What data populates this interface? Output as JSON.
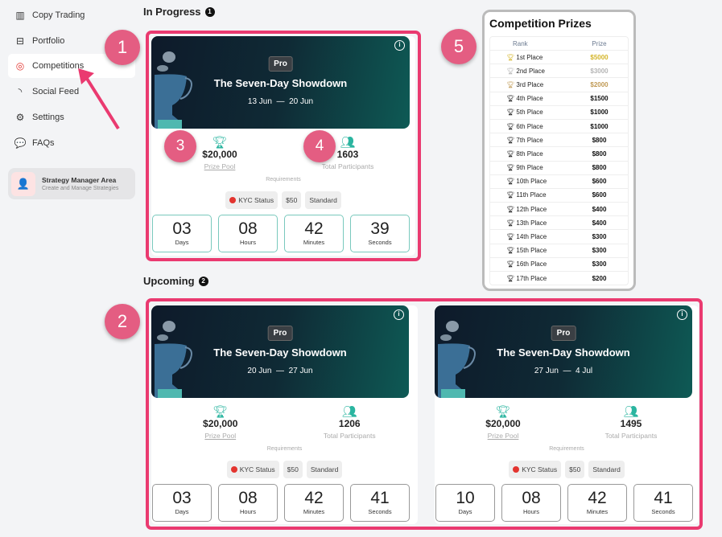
{
  "sidebar": {
    "items": [
      {
        "label": "Copy Trading",
        "icon": "bar-chart-icon",
        "glyph": "▥"
      },
      {
        "label": "Portfolio",
        "icon": "briefcase-icon",
        "glyph": "⊟"
      },
      {
        "label": "Competitions",
        "icon": "award-icon",
        "glyph": "◎",
        "active": true
      },
      {
        "label": "Social Feed",
        "icon": "rss-icon",
        "glyph": "◝"
      },
      {
        "label": "Settings",
        "icon": "gear-icon",
        "glyph": "⚙"
      },
      {
        "label": "FAQs",
        "icon": "chat-icon",
        "glyph": "💬"
      }
    ],
    "manager": {
      "title": "Strategy Manager Area",
      "subtitle": "Create and Manage Strategies"
    }
  },
  "in_progress": {
    "title": "In Progress",
    "count": "1"
  },
  "upcoming": {
    "title": "Upcoming",
    "count": "2"
  },
  "cards": [
    {
      "tag": "Pro",
      "title": "The Seven-Day Showdown",
      "start": "13 Jun",
      "end": "20 Jun",
      "prize": "$20,000",
      "prize_label": "Prize Pool",
      "participants": "1603",
      "participants_label": "Total Participants",
      "requirements_label": "Requirements",
      "chips": [
        "KYC Status",
        "$50",
        "Standard"
      ],
      "timer": [
        {
          "v": "03",
          "l": "Days"
        },
        {
          "v": "08",
          "l": "Hours"
        },
        {
          "v": "42",
          "l": "Minutes"
        },
        {
          "v": "39",
          "l": "Seconds"
        }
      ]
    },
    {
      "tag": "Pro",
      "title": "The Seven-Day Showdown",
      "start": "20 Jun",
      "end": "27 Jun",
      "prize": "$20,000",
      "prize_label": "Prize Pool",
      "participants": "1206",
      "participants_label": "Total Participants",
      "requirements_label": "Requirements",
      "chips": [
        "KYC Status",
        "$50",
        "Standard"
      ],
      "timer": [
        {
          "v": "03",
          "l": "Days"
        },
        {
          "v": "08",
          "l": "Hours"
        },
        {
          "v": "42",
          "l": "Minutes"
        },
        {
          "v": "41",
          "l": "Seconds"
        }
      ]
    },
    {
      "tag": "Pro",
      "title": "The Seven-Day Showdown",
      "start": "27 Jun",
      "end": "4 Jul",
      "prize": "$20,000",
      "prize_label": "Prize Pool",
      "participants": "1495",
      "participants_label": "Total Participants",
      "requirements_label": "Requirements",
      "chips": [
        "KYC Status",
        "$50",
        "Standard"
      ],
      "timer": [
        {
          "v": "10",
          "l": "Days"
        },
        {
          "v": "08",
          "l": "Hours"
        },
        {
          "v": "42",
          "l": "Minutes"
        },
        {
          "v": "41",
          "l": "Seconds"
        }
      ]
    }
  ],
  "prizes": {
    "title": "Competition Prizes",
    "headers": [
      "Rank",
      "Prize"
    ],
    "rows": [
      {
        "rank": "1st Place",
        "prize": "$5000",
        "color": "#d4b52a"
      },
      {
        "rank": "2nd Place",
        "prize": "$3000",
        "color": "#b5b5b5"
      },
      {
        "rank": "3rd Place",
        "prize": "$2000",
        "color": "#c09a55"
      },
      {
        "rank": "4th Place",
        "prize": "$1500"
      },
      {
        "rank": "5th Place",
        "prize": "$1000"
      },
      {
        "rank": "6th Place",
        "prize": "$1000"
      },
      {
        "rank": "7th Place",
        "prize": "$800"
      },
      {
        "rank": "8th Place",
        "prize": "$800"
      },
      {
        "rank": "9th Place",
        "prize": "$800"
      },
      {
        "rank": "10th Place",
        "prize": "$600"
      },
      {
        "rank": "11th Place",
        "prize": "$600"
      },
      {
        "rank": "12th Place",
        "prize": "$400"
      },
      {
        "rank": "13th Place",
        "prize": "$400"
      },
      {
        "rank": "14th Place",
        "prize": "$300"
      },
      {
        "rank": "15th Place",
        "prize": "$300"
      },
      {
        "rank": "16th Place",
        "prize": "$300"
      },
      {
        "rank": "17th Place",
        "prize": "$200"
      }
    ]
  },
  "annotations": [
    "1",
    "2",
    "3",
    "4",
    "5"
  ],
  "colors": {
    "highlight": "#ea3a70",
    "annotation": "#e45d82",
    "accent": "#2bb5a0"
  }
}
